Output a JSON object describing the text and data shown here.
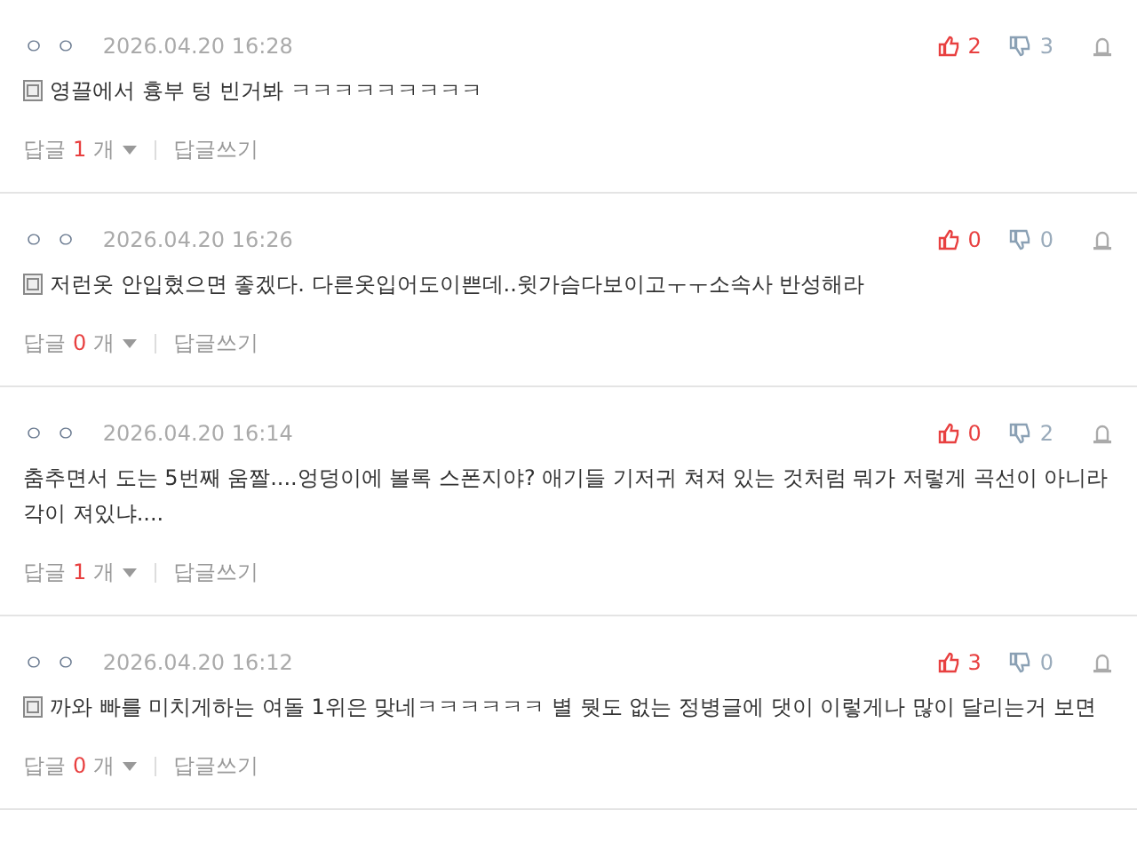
{
  "comments": [
    {
      "author": "ㅇ ㅇ",
      "date": "2026.04.20 16:28",
      "has_note_icon": true,
      "text": "영끌에서 흉부 텅 빈거봐 ㅋㅋㅋㅋㅋㅋㅋㅋㅋ",
      "likes": "2",
      "dislikes": "3",
      "reply_label": "답글",
      "reply_count": "1",
      "reply_unit": "개",
      "write_reply": "답글쓰기"
    },
    {
      "author": "ㅇ ㅇ",
      "date": "2026.04.20 16:26",
      "has_note_icon": true,
      "text": "저런옷 안입혔으면 좋겠다. 다른옷입어도이쁜데..윗가슴다보이고ㅜㅜ소속사 반성해라",
      "likes": "0",
      "dislikes": "0",
      "reply_label": "답글",
      "reply_count": "0",
      "reply_unit": "개",
      "write_reply": "답글쓰기"
    },
    {
      "author": "ㅇ ㅇ",
      "date": "2026.04.20 16:14",
      "has_note_icon": false,
      "text": "춤추면서 도는 5번째 움짤....엉덩이에 볼록 스폰지야? 애기들 기저귀 쳐져 있는 것처럼 뭐가 저렇게 곡선이 아니라 각이 져있냐....",
      "likes": "0",
      "dislikes": "2",
      "reply_label": "답글",
      "reply_count": "1",
      "reply_unit": "개",
      "write_reply": "답글쓰기"
    },
    {
      "author": "ㅇ ㅇ",
      "date": "2026.04.20 16:12",
      "has_note_icon": true,
      "text": "까와 빠를 미치게하는 여돌 1위은 맞네ㅋㅋㅋㅋㅋㅋ 별 뭣도 없는 정병글에 댓이 이렇게나 많이 달리는거 보면",
      "likes": "3",
      "dislikes": "0",
      "reply_label": "답글",
      "reply_count": "0",
      "reply_unit": "개",
      "write_reply": "답글쓰기"
    }
  ]
}
